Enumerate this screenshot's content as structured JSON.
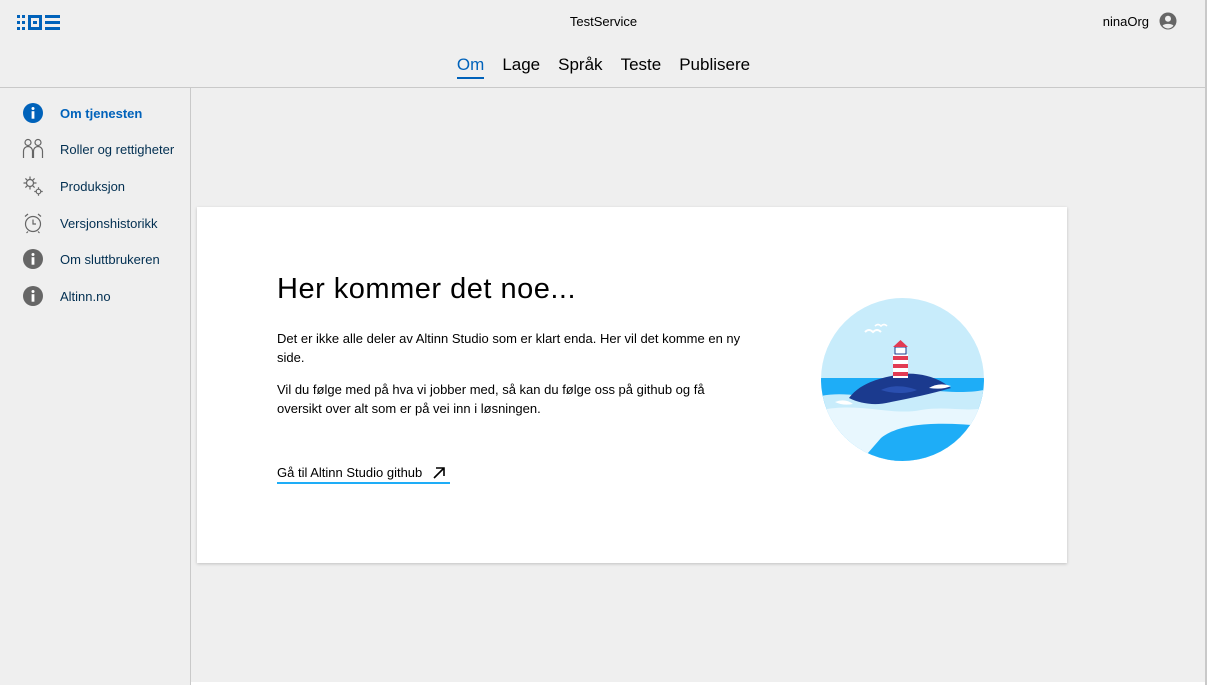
{
  "header": {
    "app_title": "TestService",
    "user_name": "ninaOrg",
    "tabs": [
      {
        "label": "Om",
        "active": true
      },
      {
        "label": "Lage",
        "active": false
      },
      {
        "label": "Språk",
        "active": false
      },
      {
        "label": "Teste",
        "active": false
      },
      {
        "label": "Publisere",
        "active": false
      }
    ]
  },
  "sidebar": {
    "items": [
      {
        "label": "Om tjenesten",
        "icon": "info-icon",
        "active": true
      },
      {
        "label": "Roller og rettigheter",
        "icon": "people-icon",
        "active": false
      },
      {
        "label": "Produksjon",
        "icon": "gears-icon",
        "active": false
      },
      {
        "label": "Versjonshistorikk",
        "icon": "clock-icon",
        "active": false
      },
      {
        "label": "Om sluttbrukeren",
        "icon": "info-icon",
        "active": false
      },
      {
        "label": "Altinn.no",
        "icon": "info-icon",
        "active": false
      }
    ]
  },
  "main": {
    "heading": "Her kommer det noe...",
    "paragraph1": "Det er ikke alle deler av Altinn Studio som er klart enda. Her vil det komme en ny side.",
    "paragraph2": "Vil du følge med på hva vi jobber med, så kan du følge oss på github og få oversikt over alt som er på vei inn i løsningen.",
    "link_label": "Gå til Altinn Studio github"
  },
  "colors": {
    "accent": "#0062ba",
    "link_underline": "#1eadf7",
    "nav_text": "#022f51",
    "background": "#efefef"
  }
}
